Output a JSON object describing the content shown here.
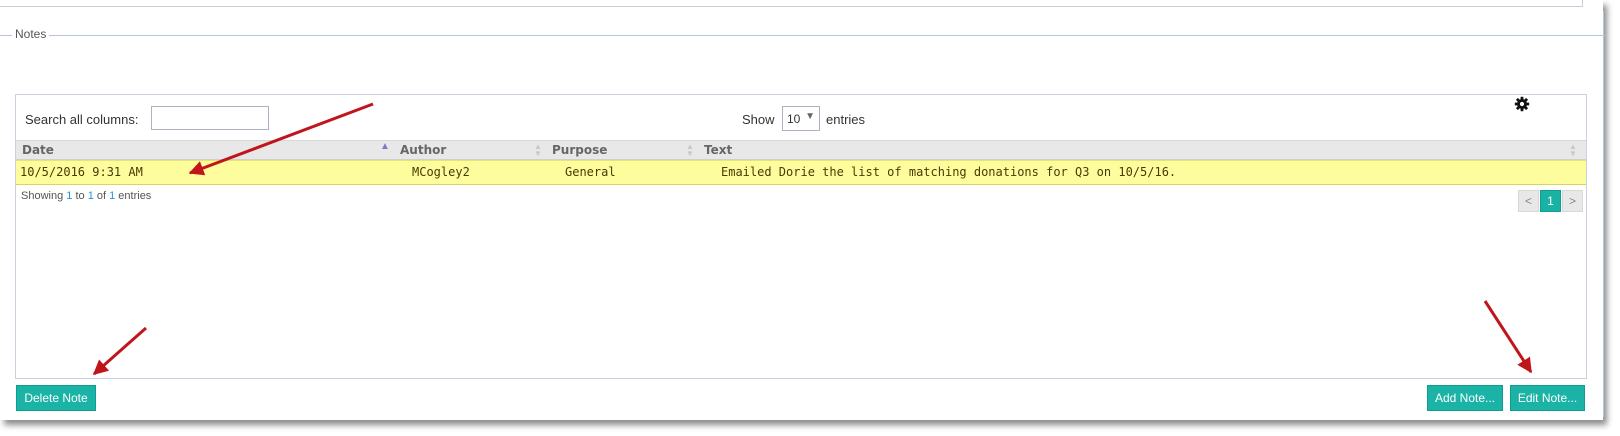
{
  "section": {
    "legend": "Notes"
  },
  "toolbar": {
    "search_label": "Search all columns:",
    "search_value": "",
    "show_label": "Show",
    "entries_value": "10",
    "entries_label": "entries"
  },
  "table": {
    "columns": [
      "Date",
      "Author",
      "Purpose",
      "Text"
    ],
    "sort": {
      "column": "Date",
      "direction": "ascending"
    },
    "rows": [
      {
        "date": "10/5/2016 9:31 AM",
        "author": "MCogley2",
        "purpose": "General",
        "text": "Emailed Dorie the list of matching donations for Q3 on 10/5/16.",
        "highlighted": true
      }
    ]
  },
  "info": {
    "prefix": "Showing ",
    "start": "1",
    "to": " to ",
    "end": "1",
    "of": " of ",
    "total": "1",
    "suffix": " entries"
  },
  "pagination": {
    "prev": "<",
    "current": "1",
    "next": ">"
  },
  "buttons": {
    "delete": "Delete Note",
    "add": "Add Note...",
    "edit": "Edit Note..."
  },
  "icons": {
    "settings": "gear-icon",
    "annotation_arrow": "arrow-icon"
  },
  "colors": {
    "accent": "#1ab3a6",
    "row_highlight": "#fdfd9e",
    "annotation_arrow": "#c0161b"
  }
}
